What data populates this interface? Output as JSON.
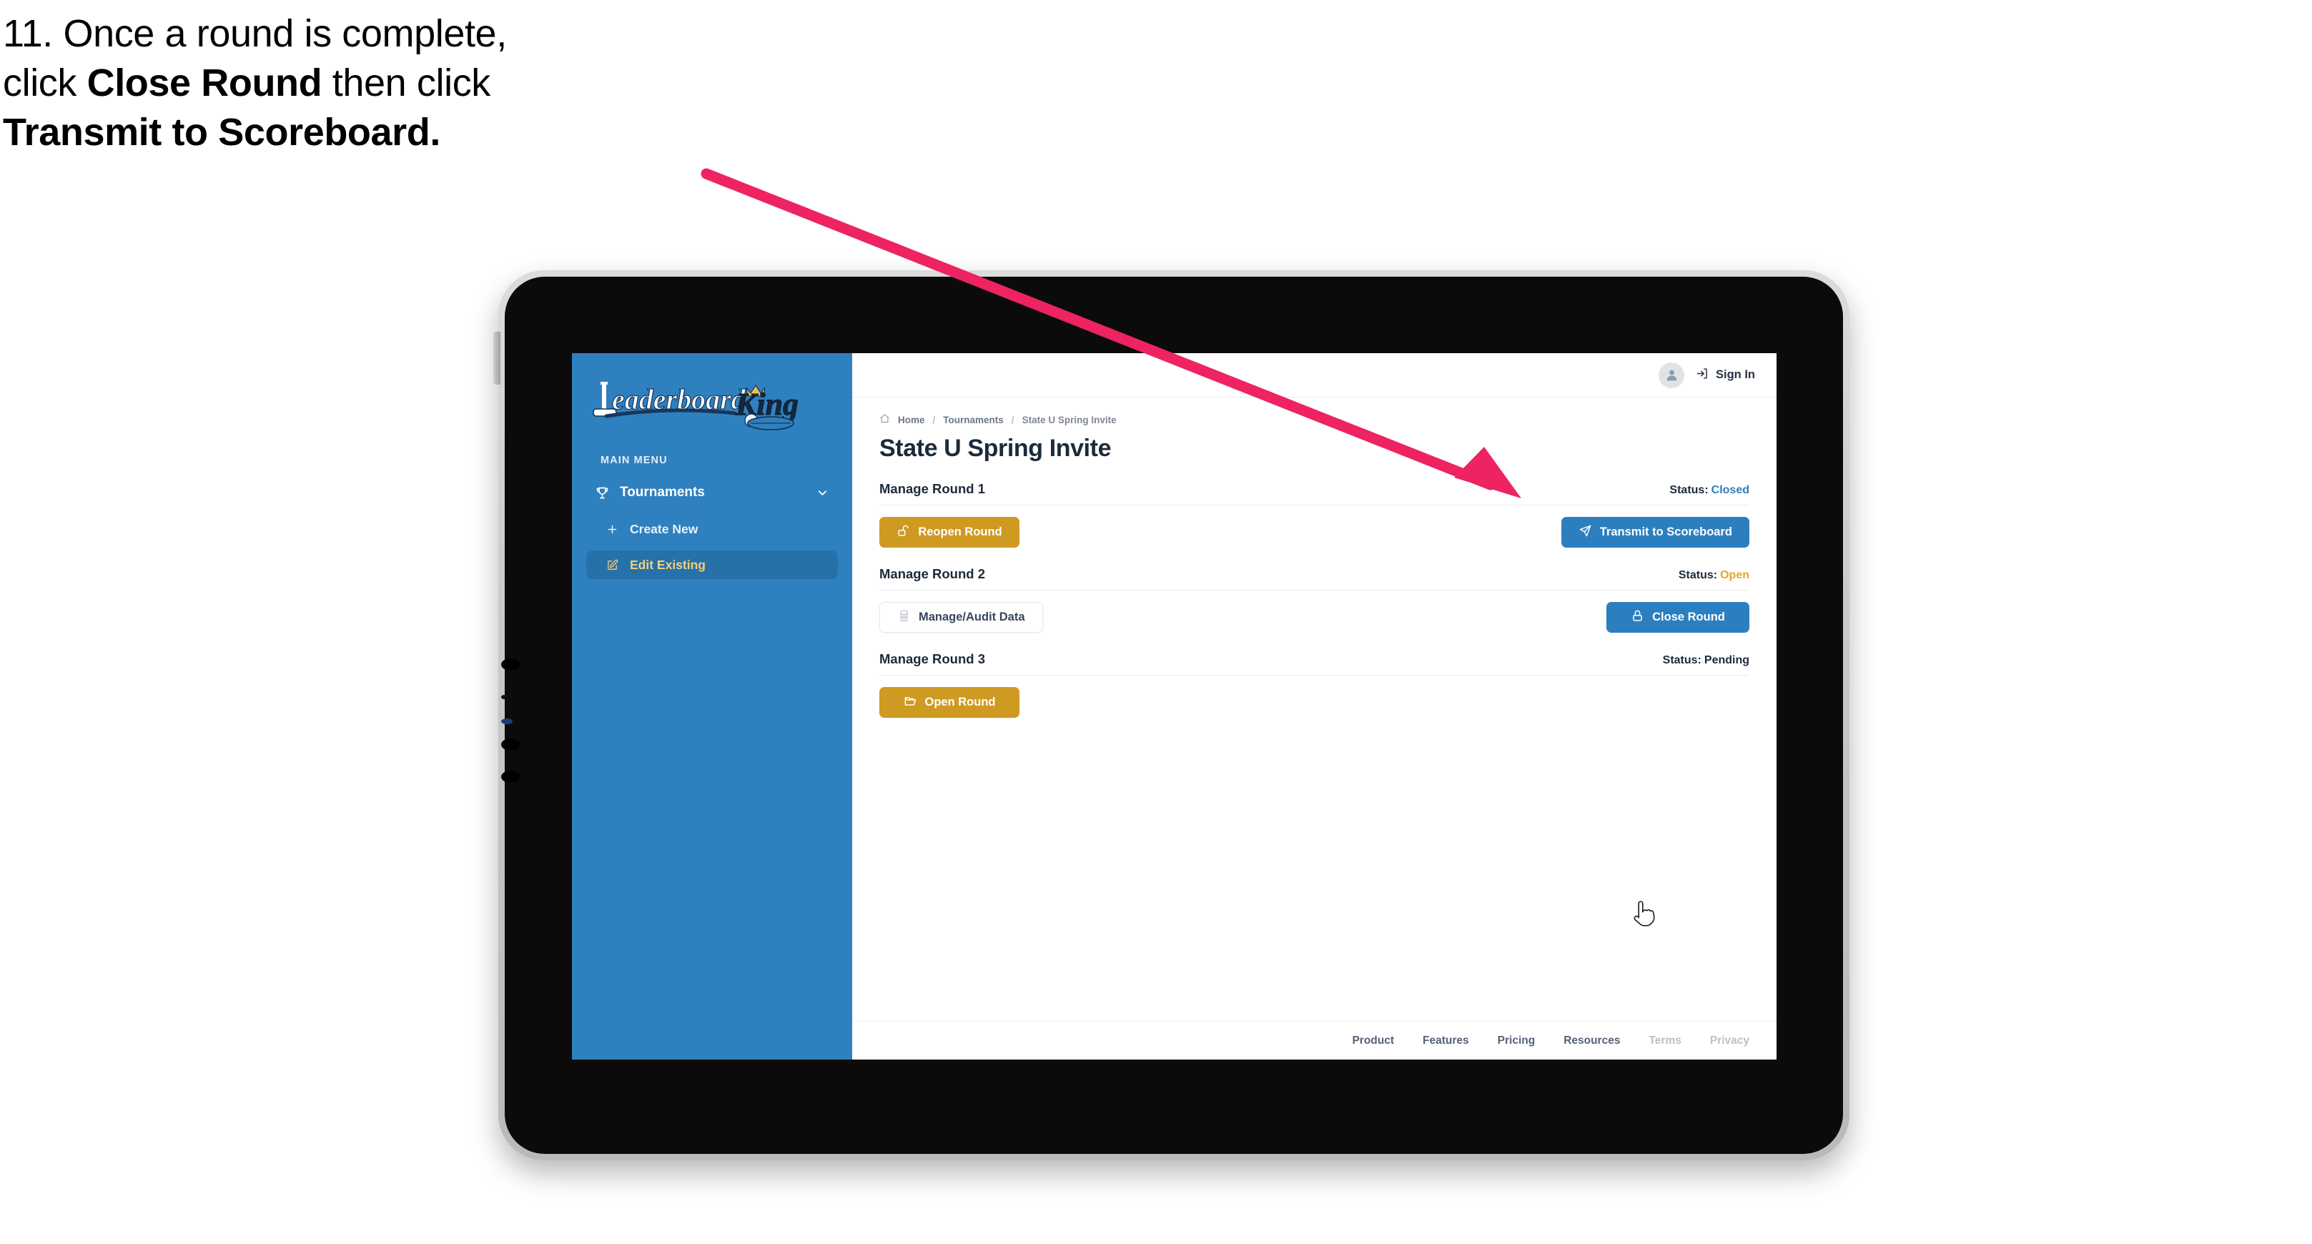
{
  "caption": {
    "line1": "11. Once a round is complete,",
    "line2_pre": "click ",
    "line2_bold": "Close Round",
    "line2_post": " then click",
    "line3_bold": "Transmit to Scoreboard."
  },
  "colors": {
    "accent_blue": "#2c7fbf",
    "sidebar_blue": "#2f80bf",
    "gold": "#cf9a22",
    "arrow_pink": "#ed2362",
    "status_closed": "#2c7fbf",
    "status_open": "#e0a732",
    "status_pending": "#1d2a3a"
  },
  "sidebar": {
    "logo_primary": "Leaderboard",
    "logo_secondary": "King",
    "menu_title": "MAIN MENU",
    "items": [
      {
        "label": "Tournaments",
        "icon": "trophy-icon",
        "expanded": true
      },
      {
        "label": "Create New",
        "icon": "plus-icon",
        "active": false
      },
      {
        "label": "Edit Existing",
        "icon": "edit-pencil-icon",
        "active": true
      }
    ]
  },
  "topbar": {
    "avatar_icon": "user-avatar-icon",
    "signin_icon": "sign-in-arrow-icon",
    "signin_label": "Sign In"
  },
  "breadcrumb": {
    "home_icon": "home-icon",
    "items": [
      "Home",
      "Tournaments",
      "State U Spring Invite"
    ],
    "separator": "/"
  },
  "page_title": "State U Spring Invite",
  "rounds": [
    {
      "name": "Manage Round 1",
      "status_label": "Status:",
      "status_value": "Closed",
      "status_color": "#2c7fbf",
      "left_button": {
        "label": "Reopen Round",
        "icon": "unlock-icon",
        "style": "gold"
      },
      "right_button": {
        "label": "Transmit to Scoreboard",
        "icon": "paper-plane-icon",
        "style": "blue"
      }
    },
    {
      "name": "Manage Round 2",
      "status_label": "Status:",
      "status_value": "Open",
      "status_color": "#e0a732",
      "left_button": {
        "label": "Manage/Audit Data",
        "icon": "table-grid-icon",
        "style": "ghost"
      },
      "right_button": {
        "label": "Close Round",
        "icon": "lock-closed-icon",
        "style": "blue"
      }
    },
    {
      "name": "Manage Round 3",
      "status_label": "Status:",
      "status_value": "Pending",
      "status_color": "#1d2a3a",
      "left_button": {
        "label": "Open Round",
        "icon": "open-folder-icon",
        "style": "gold"
      },
      "right_button": null
    }
  ],
  "footer": {
    "links": [
      {
        "label": "Product",
        "muted": false
      },
      {
        "label": "Features",
        "muted": false
      },
      {
        "label": "Pricing",
        "muted": false
      },
      {
        "label": "Resources",
        "muted": false
      },
      {
        "label": "Terms",
        "muted": true
      },
      {
        "label": "Privacy",
        "muted": true
      }
    ]
  },
  "annotation": {
    "arrow_icon": "pointer-arrow",
    "cursor_icon": "hand-pointer-cursor"
  }
}
